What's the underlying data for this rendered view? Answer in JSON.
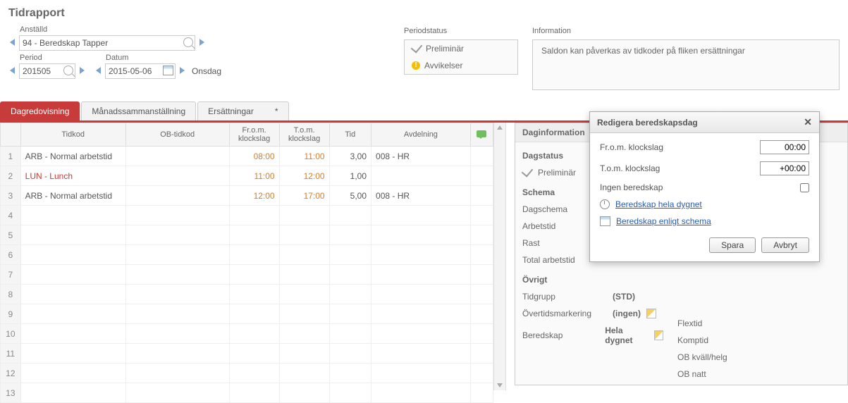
{
  "title": "Tidrapport",
  "filters": {
    "employee_label": "Anställd",
    "employee_value": "94 - Beredskap Tapper",
    "period_label": "Period",
    "period_value": "201505",
    "date_label": "Datum",
    "date_value": "2015-05-06",
    "weekday": "Onsdag"
  },
  "periodstatus": {
    "title": "Periodstatus",
    "items": [
      {
        "icon": "check",
        "text": "Preliminär"
      },
      {
        "icon": "warn",
        "text": "Avvikelser"
      }
    ]
  },
  "information": {
    "title": "Information",
    "text": "Saldon kan påverkas av tidkoder på fliken ersättningar"
  },
  "tabs": [
    {
      "label": "Dagredovisning",
      "active": true
    },
    {
      "label": "Månadssammanställning"
    },
    {
      "label": "Ersättningar",
      "dirty": true
    }
  ],
  "grid": {
    "headers": {
      "tidkod": "Tidkod",
      "obtidkod": "OB-tidkod",
      "from": "Fr.o.m. klockslag",
      "tom": "T.o.m. klockslag",
      "tid": "Tid",
      "avdelning": "Avdelning"
    },
    "rows": [
      {
        "n": "1",
        "tidkod": "ARB - Normal arbetstid",
        "ob": "",
        "from": "08:00",
        "tom": "11:00",
        "tid": "3,00",
        "avd": "008 - HR",
        "red": false
      },
      {
        "n": "2",
        "tidkod": "LUN - Lunch",
        "ob": "",
        "from": "11:00",
        "tom": "12:00",
        "tid": "1,00",
        "avd": "",
        "red": true
      },
      {
        "n": "3",
        "tidkod": "ARB - Normal arbetstid",
        "ob": "",
        "from": "12:00",
        "tom": "17:00",
        "tid": "5,00",
        "avd": "008 - HR",
        "red": false
      },
      {
        "n": "4"
      },
      {
        "n": "5"
      },
      {
        "n": "6"
      },
      {
        "n": "7"
      },
      {
        "n": "8"
      },
      {
        "n": "9"
      },
      {
        "n": "10"
      },
      {
        "n": "11"
      },
      {
        "n": "12"
      },
      {
        "n": "13"
      }
    ]
  },
  "daginfo": {
    "title": "Daginformation",
    "dagstatus_label": "Dagstatus",
    "dagstatus_value": "Preliminär",
    "schema_label": "Schema",
    "dagschema": "Dagschema",
    "arbetstid": "Arbetstid",
    "rast": "Rast",
    "total": "Total arbetstid",
    "ovrigt_label": "Övrigt",
    "tidgrupp_label": "Tidgrupp",
    "tidgrupp_value": "(STD)",
    "overtid_label": "Övertidsmarkering",
    "overtid_value": "(ingen)",
    "beredskap_label": "Beredskap",
    "beredskap_value": "Hela dygnet",
    "right_items": [
      "Flextid",
      "Komptid",
      "OB kväll/helg",
      "OB natt"
    ]
  },
  "dialog": {
    "title": "Redigera beredskapsdag",
    "from_label": "Fr.o.m. klockslag",
    "from_value": "00:00",
    "tom_label": "T.o.m. klockslag",
    "tom_value": "+00:00",
    "ingen_label": "Ingen beredskap",
    "link1": "Beredskap hela dygnet",
    "link2": "Beredskap enligt schema",
    "save": "Spara",
    "cancel": "Avbryt"
  }
}
